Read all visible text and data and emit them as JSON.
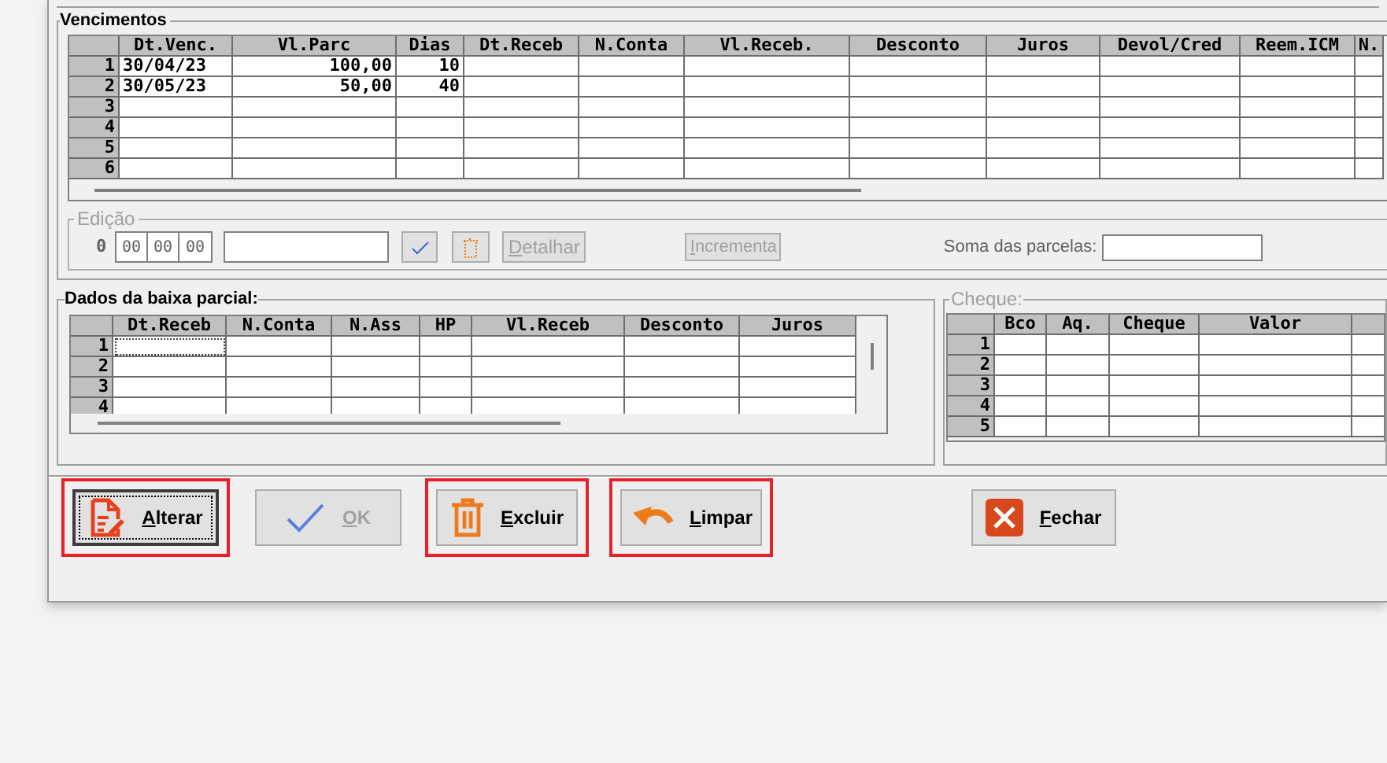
{
  "vencimentos": {
    "title": "Vencimentos",
    "columns": [
      "Dt.Venc.",
      "Vl.Parc",
      "Dias",
      "Dt.Receb",
      "N.Conta",
      "Vl.Receb.",
      "Desconto",
      "Juros",
      "Devol/Cred",
      "Reem.ICM",
      "N."
    ],
    "rows": [
      {
        "number": "1",
        "cells": [
          "30/04/23",
          "100,00",
          "10"
        ]
      },
      {
        "number": "2",
        "cells": [
          "30/05/23",
          "50,00",
          "40"
        ]
      },
      {
        "number": "3",
        "cells": []
      },
      {
        "number": "4",
        "cells": []
      },
      {
        "number": "5",
        "cells": []
      },
      {
        "number": "6",
        "cells": []
      }
    ]
  },
  "edicao": {
    "title": "Edição",
    "disabled": true,
    "index": "0",
    "date_parts": [
      "00",
      "00",
      "00"
    ],
    "buttons": [
      {
        "kind": "confirm",
        "disabled": false
      },
      {
        "kind": "delete",
        "disabled": false
      },
      {
        "kind": "text",
        "label": "Detalhar",
        "disabled": true
      },
      {
        "kind": "text",
        "label": "Incrementa",
        "disabled": true
      }
    ],
    "sum_label": "Soma das parcelas:"
  },
  "baixa_parcial": {
    "title": "Dados da baixa parcial:",
    "columns": [
      "Dt.Receb",
      "N.Conta",
      "N.Ass",
      "HP",
      "Vl.Receb",
      "Desconto",
      "Juros"
    ],
    "rows": [
      {
        "number": "1",
        "focused": true
      },
      {
        "number": "2",
        "focused": false
      },
      {
        "number": "3",
        "focused": false
      },
      {
        "number": "4",
        "focused": false
      }
    ]
  },
  "cheque": {
    "title": "Cheque:",
    "disabled": true,
    "columns": [
      "Bco",
      "Aq.",
      "Cheque",
      "Valor"
    ],
    "rows": [
      {
        "number": "1"
      },
      {
        "number": "2"
      },
      {
        "number": "3"
      },
      {
        "number": "4"
      },
      {
        "number": "5"
      }
    ]
  },
  "buttons": [
    {
      "kind": "edit",
      "label": "Alterar",
      "disabled": false,
      "focused": true,
      "highlighted": true
    },
    {
      "kind": "ok",
      "label": "OK",
      "disabled": true,
      "focused": false,
      "highlighted": false
    },
    {
      "kind": "delete",
      "label": "Excluir",
      "disabled": false,
      "focused": false,
      "highlighted": true
    },
    {
      "kind": "undo",
      "label": "Limpar",
      "disabled": false,
      "focused": false,
      "highlighted": true
    },
    {
      "kind": "close",
      "label": "Fechar",
      "disabled": false,
      "focused": false,
      "highlighted": false
    }
  ]
}
